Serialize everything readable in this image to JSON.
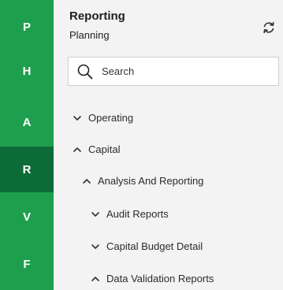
{
  "rail": {
    "items": [
      {
        "label": "P",
        "active": false
      },
      {
        "label": "H",
        "active": false
      },
      {
        "label": "A",
        "active": false
      },
      {
        "label": "R",
        "active": true
      },
      {
        "label": "V",
        "active": false
      },
      {
        "label": "F",
        "active": false
      }
    ]
  },
  "panel": {
    "title": "Reporting",
    "subtitle": "Planning",
    "refresh_icon": "refresh-icon"
  },
  "search": {
    "placeholder": "Search",
    "value": ""
  },
  "tree": [
    {
      "label": "Operating",
      "expanded": false,
      "level": 0
    },
    {
      "label": "Capital",
      "expanded": true,
      "level": 0
    },
    {
      "label": "Analysis And Reporting",
      "expanded": true,
      "level": 1
    },
    {
      "label": "Audit Reports",
      "expanded": false,
      "level": 2
    },
    {
      "label": "Capital Budget Detail",
      "expanded": false,
      "level": 2
    },
    {
      "label": "Data Validation Reports",
      "expanded": true,
      "level": 2
    }
  ],
  "colors": {
    "rail": "#1e9f4d",
    "rail_active": "#0d6b37",
    "panel": "#f3f3f3"
  }
}
